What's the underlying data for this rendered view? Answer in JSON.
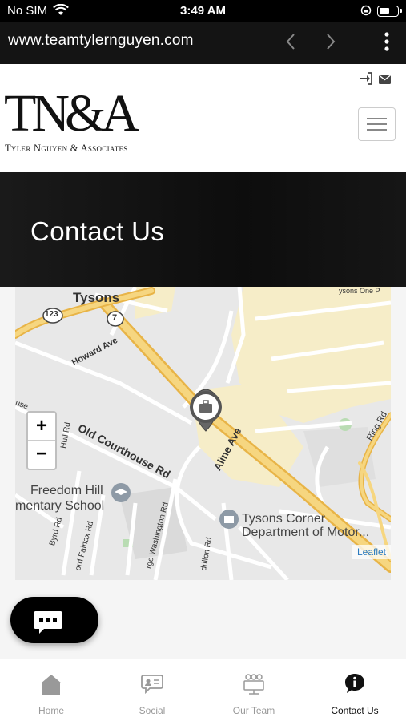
{
  "status_bar": {
    "carrier": "No SIM",
    "time": "3:49 AM"
  },
  "browser": {
    "url": "www.teamtylernguyen.com"
  },
  "header": {
    "logo_mark": "TN&A",
    "logo_tagline": "Tyler Nguyen & Associates"
  },
  "hero": {
    "title": "Contact Us"
  },
  "map": {
    "labels": {
      "tysons": "Tysons",
      "howard_ave": "Howard Ave",
      "old_courthouse": "Old Courthouse Rd",
      "aline_ave": "Aline Ave",
      "freedom_hill": "Freedom Hill",
      "school": "mentary School",
      "tysons_corner": "Tysons Corner",
      "dmv": "Department of Motor...",
      "ring_rd": "Ring Rd",
      "byrd_rd": "Byrd Rd",
      "fairfax_rd": "ord Fairfax Rd",
      "washington_rd": "rge Washington Rd",
      "drillion_rd": "drillon Rd",
      "hull_rd": "Hull Rd",
      "tysons_one": "ysons One P",
      "route_123": "123",
      "route_7": "7",
      "use": "use"
    },
    "zoom_in": "+",
    "zoom_out": "−",
    "attribution": "Leaflet"
  },
  "bottom_nav": {
    "items": [
      {
        "label": "Home",
        "icon": "home-icon"
      },
      {
        "label": "Social",
        "icon": "social-icon"
      },
      {
        "label": "Our Team",
        "icon": "team-icon"
      },
      {
        "label": "Contact Us",
        "icon": "info-icon"
      }
    ],
    "active_index": 3
  },
  "colors": {
    "accent": "#f0b93a",
    "dark": "#111111",
    "link": "#2a7abf"
  }
}
